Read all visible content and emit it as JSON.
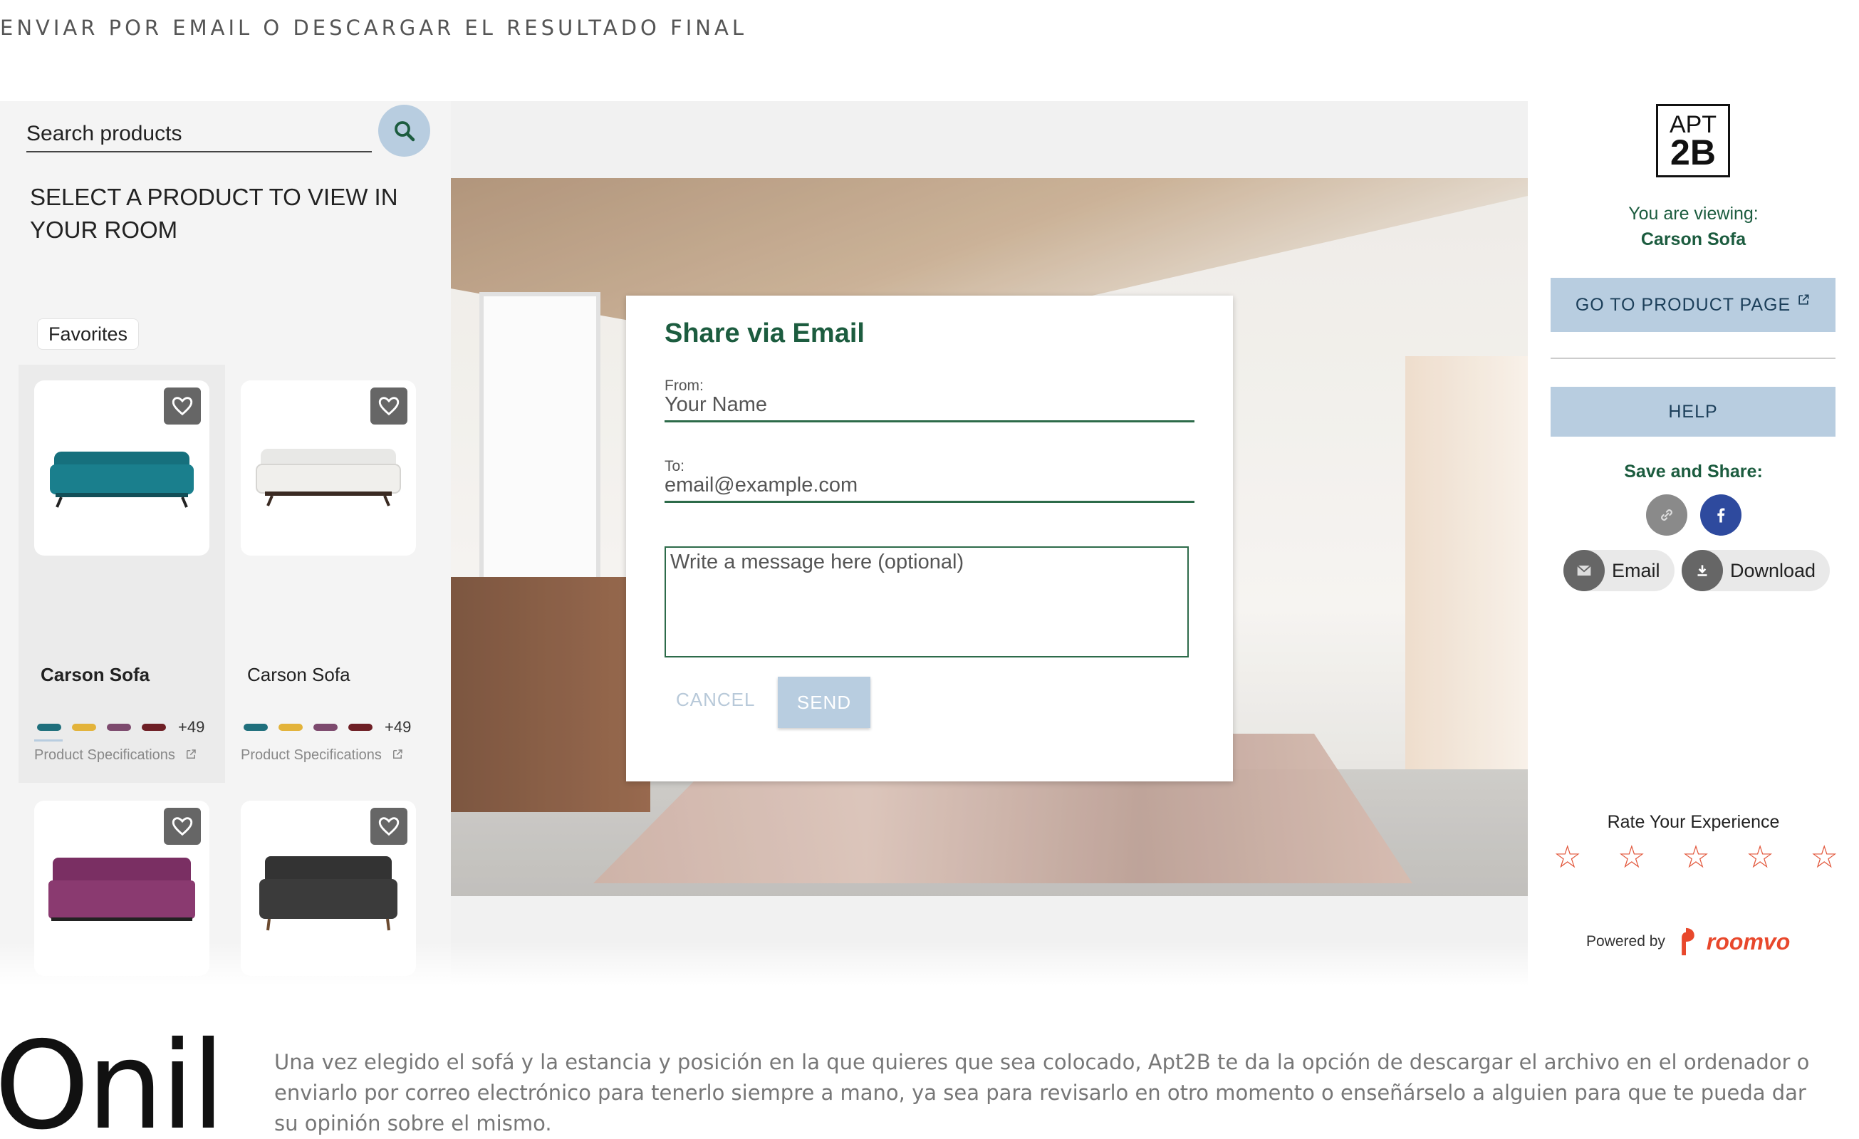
{
  "page_heading": "ENVIAR POR EMAIL O DESCARGAR EL RESULTADO FINAL",
  "search": {
    "placeholder": "Search products"
  },
  "select_title": "SELECT A PRODUCT TO VIEW IN YOUR ROOM",
  "favorites_label": "Favorites",
  "products": [
    {
      "name": "Carson Sofa",
      "more": "+49",
      "spec": "Product Specifications",
      "swatches": [
        "#1f6f7c",
        "#e3b33a",
        "#7d4a6e",
        "#6e1f25"
      ]
    },
    {
      "name": "Carson Sofa",
      "more": "+49",
      "spec": "Product Specifications",
      "swatches": [
        "#1f6f7c",
        "#e3b33a",
        "#7d4a6e",
        "#6e1f25"
      ]
    }
  ],
  "modal": {
    "title": "Share via Email",
    "from_label": "From:",
    "from_placeholder": "Your Name",
    "to_label": "To:",
    "to_placeholder": "email@example.com",
    "message_placeholder": "Write a message here (optional)",
    "cancel": "CANCEL",
    "send": "SEND"
  },
  "right_panel": {
    "logo_top": "APT",
    "logo_bottom": "2B",
    "viewing_label": "You are viewing:",
    "viewing_product": "Carson Sofa",
    "goto_button": "GO TO PRODUCT PAGE",
    "help_button": "HELP",
    "save_share": "Save and Share:",
    "email_button": "Email",
    "download_button": "Download",
    "rate_label": "Rate Your Experience",
    "stars": [
      "☆",
      "☆",
      "☆",
      "☆",
      "☆"
    ],
    "powered_by": "Powered by",
    "powered_brand": "roomvo"
  },
  "footer": {
    "brand": "Onil",
    "text": "Una vez elegido el sofá y la estancia y posición en la que quieres que sea colocado, Apt2B te da la opción de descargar el archivo en el ordenador o enviarlo por correo electrónico para tenerlo siempre a mano, ya sea para revisarlo en otro momento o enseñárselo a alguien para que te pueda dar su opinión sobre el mismo."
  },
  "colors": {
    "accent_green": "#1c5c3f",
    "button_blue": "#b8cde0",
    "star": "#e2563a",
    "facebook": "#2e4a9e"
  }
}
